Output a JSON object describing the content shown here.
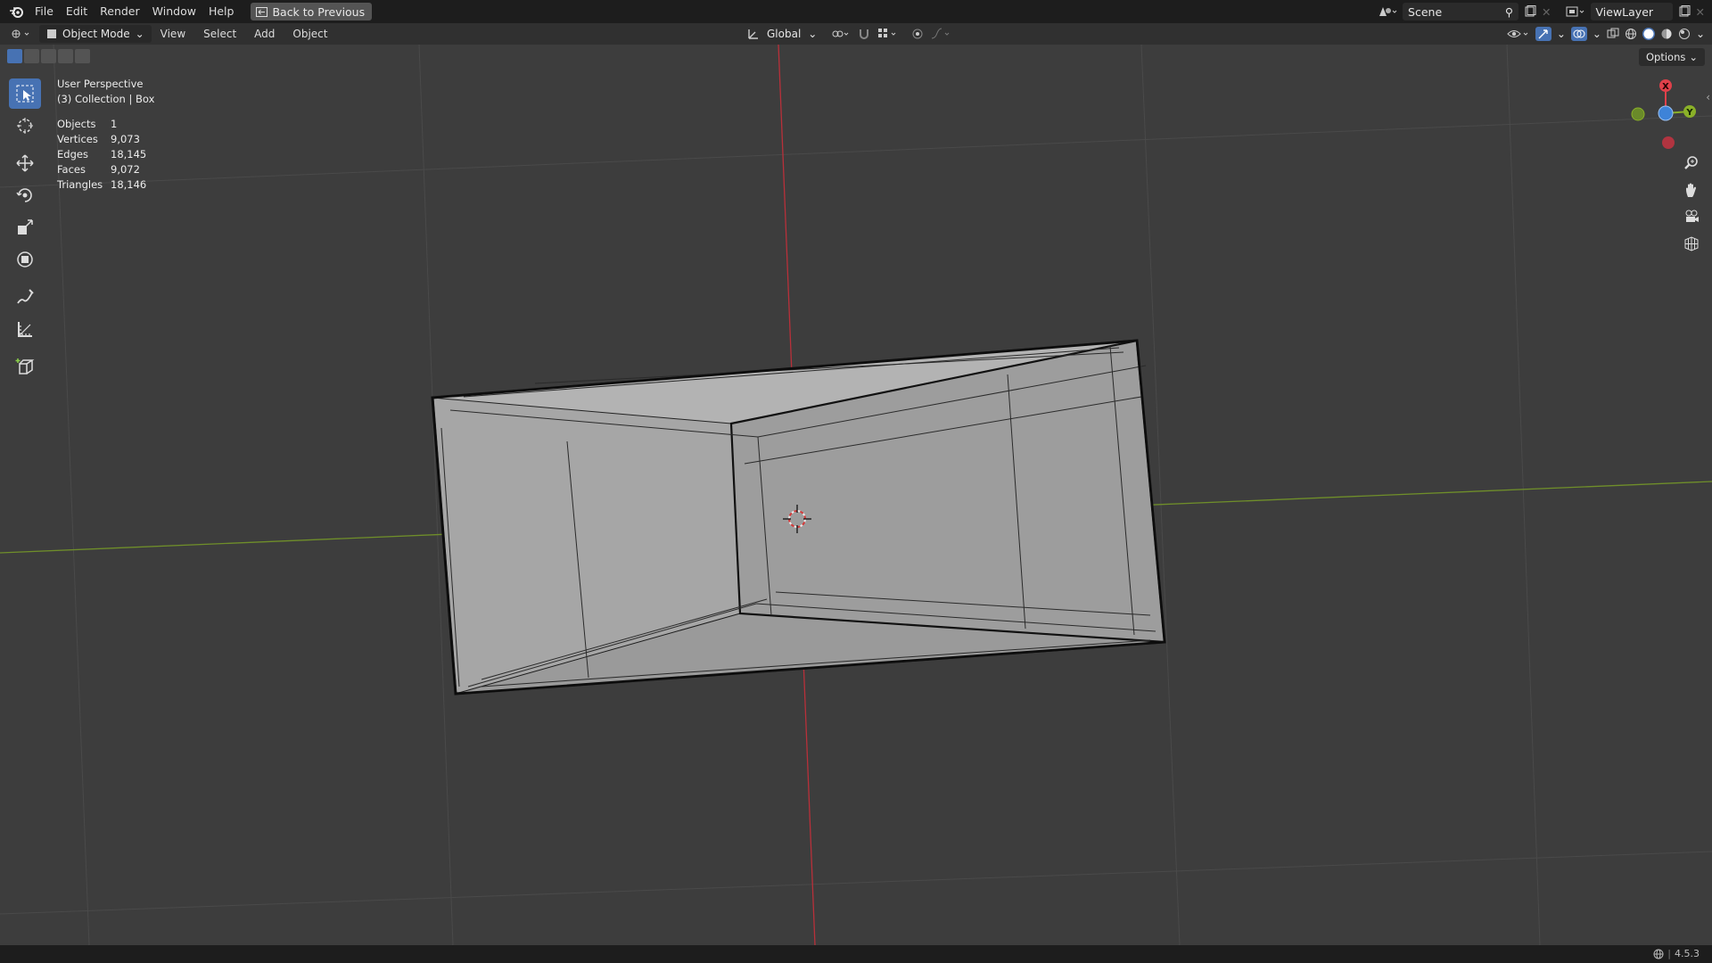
{
  "topbar": {
    "menus": [
      "File",
      "Edit",
      "Render",
      "Window",
      "Help"
    ],
    "back_button": "Back to Previous",
    "scene": "Scene",
    "view_layer": "ViewLayer"
  },
  "header": {
    "mode": "Object Mode",
    "menus": [
      "View",
      "Select",
      "Add",
      "Object"
    ],
    "transform_orientation": "Global"
  },
  "viewport": {
    "view_name": "User Perspective",
    "collection": "(3) Collection | Box",
    "options_label": "Options",
    "stats": [
      {
        "key": "Objects",
        "value": "1"
      },
      {
        "key": "Vertices",
        "value": "9,073"
      },
      {
        "key": "Edges",
        "value": "18,145"
      },
      {
        "key": "Faces",
        "value": "9,072"
      },
      {
        "key": "Triangles",
        "value": "18,146"
      }
    ],
    "gizmo": {
      "x": "X",
      "y": "Y"
    }
  },
  "status": {
    "version": "4.5.3"
  },
  "colors": {
    "accent": "#4772b3",
    "x_axis": "#e0404a",
    "y_axis": "#8ab028",
    "z_axis": "#3e83d8"
  }
}
